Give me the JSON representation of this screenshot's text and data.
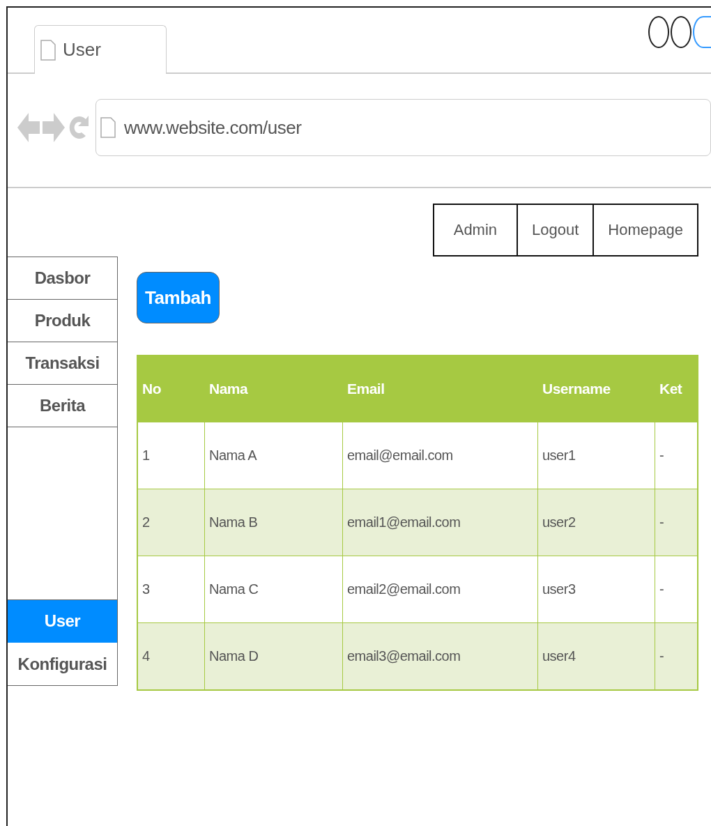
{
  "browser": {
    "tab_title": "User",
    "url": "www.website.com/user"
  },
  "top_nav": [
    {
      "label": "Admin"
    },
    {
      "label": "Logout"
    },
    {
      "label": "Homepage"
    }
  ],
  "sidebar": {
    "top_items": [
      {
        "label": "Dasbor",
        "selected": false
      },
      {
        "label": "Produk",
        "selected": false
      },
      {
        "label": "Transaksi",
        "selected": false
      },
      {
        "label": "Berita",
        "selected": false
      }
    ],
    "bottom_items": [
      {
        "label": "User",
        "selected": true
      },
      {
        "label": "Konfigurasi",
        "selected": false
      }
    ]
  },
  "add_button": "Tambah",
  "table": {
    "columns": [
      "No",
      "Nama",
      "Email",
      "Username",
      "Ket"
    ],
    "rows": [
      [
        "1",
        "Nama A",
        "email@email.com",
        "user1",
        "-"
      ],
      [
        "2",
        "Nama B",
        "email1@email.com",
        "user2",
        "-"
      ],
      [
        "3",
        "Nama C",
        "email2@email.com",
        "user3",
        "-"
      ],
      [
        "4",
        "Nama D",
        "email3@email.com",
        "user4",
        "-"
      ]
    ]
  }
}
